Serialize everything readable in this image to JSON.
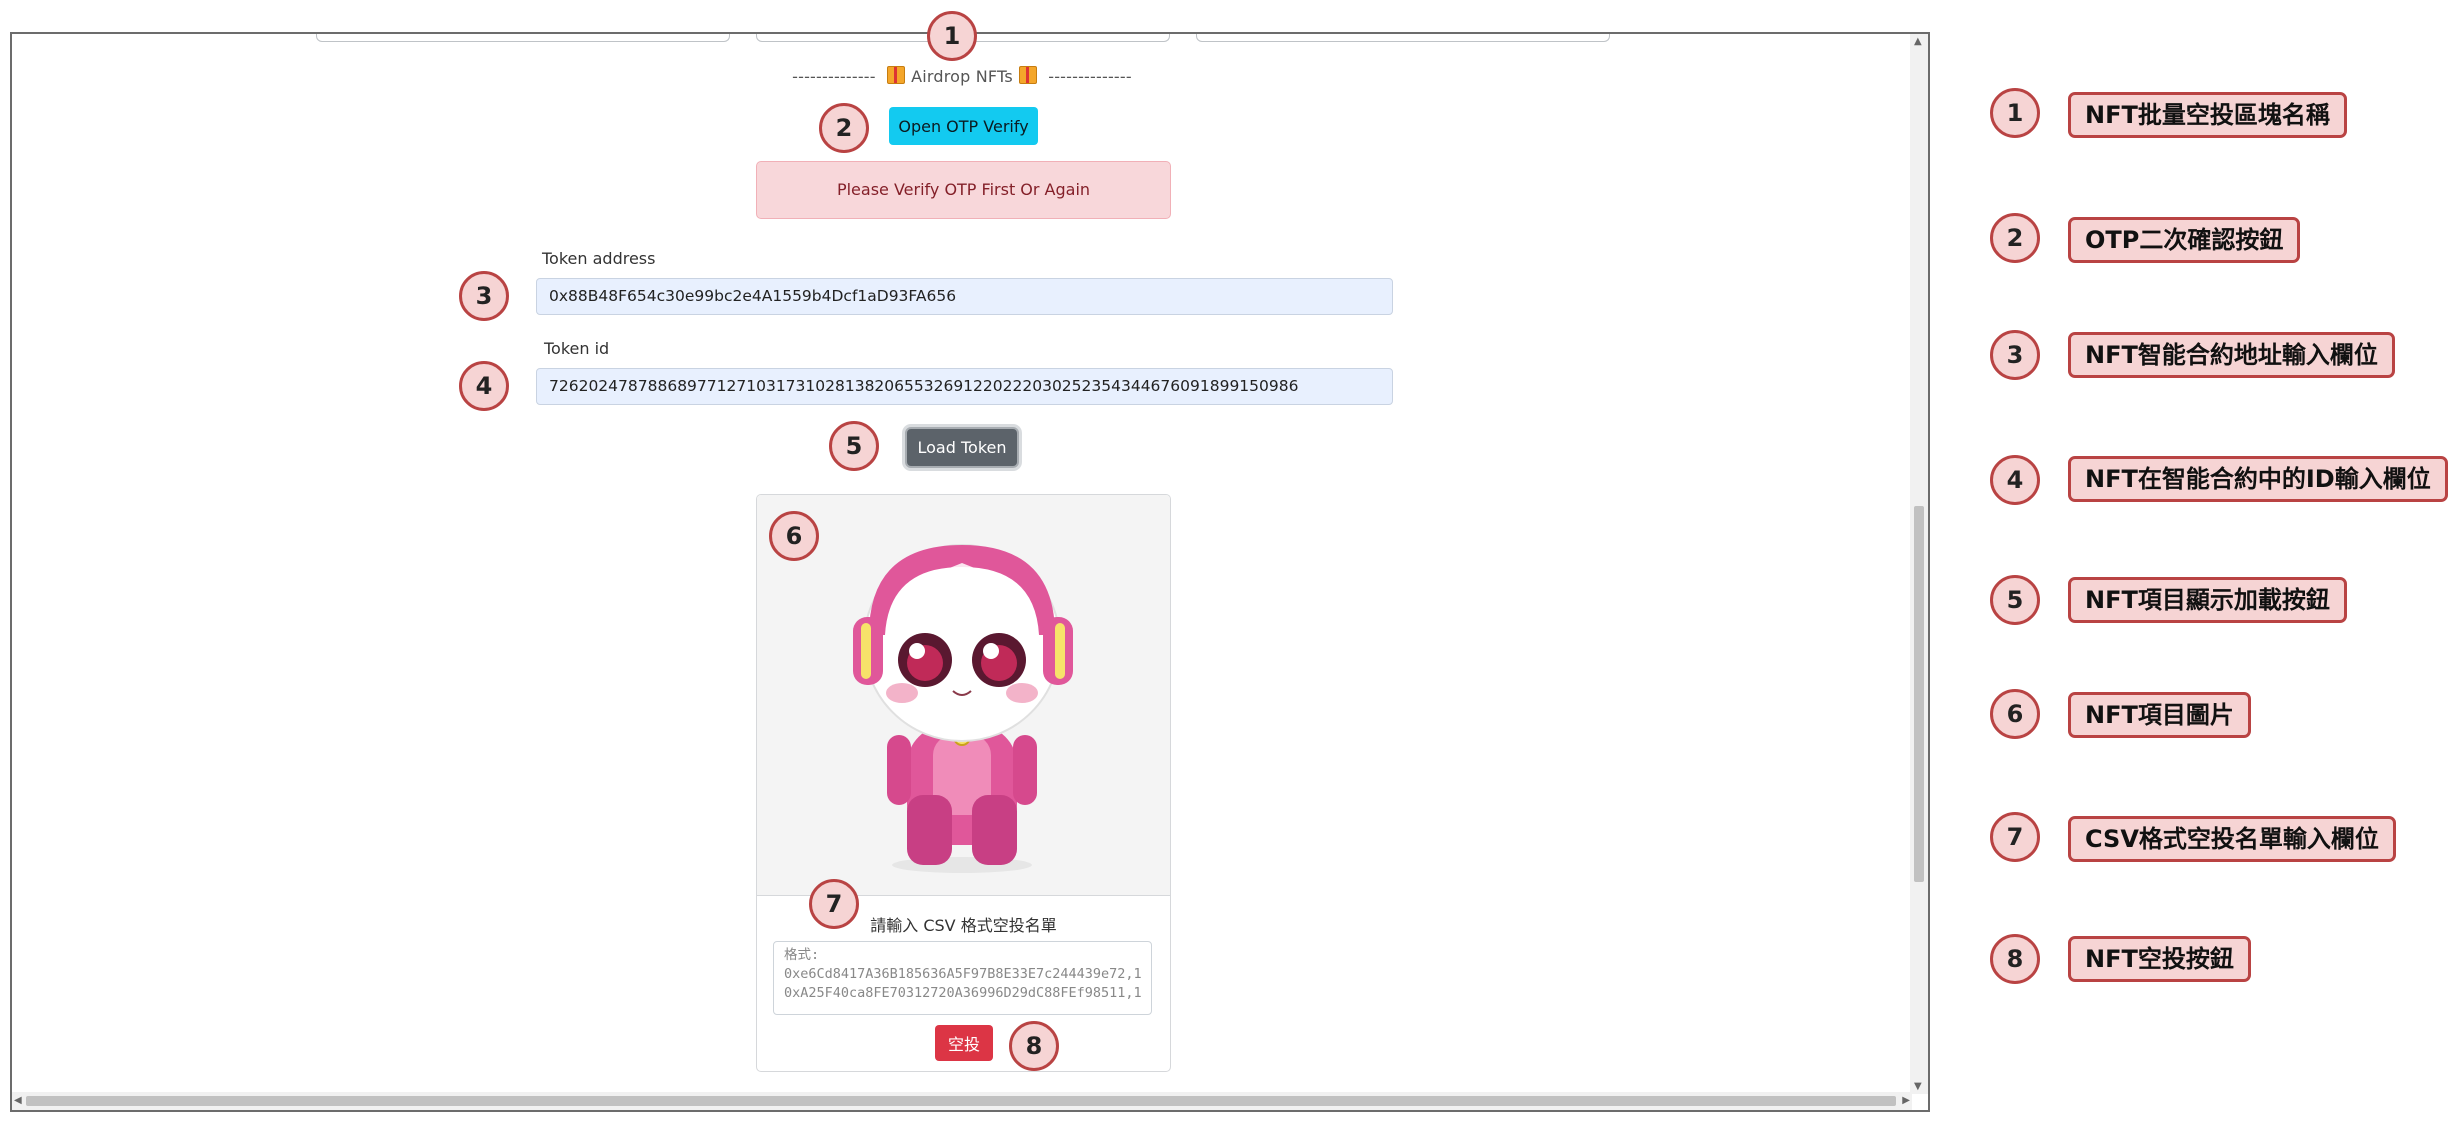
{
  "airdrop": {
    "section_title_left": "--------------",
    "section_title_text": "Airdrop NFTs",
    "section_title_right": "--------------",
    "otp_button": "Open OTP Verify",
    "alert_text": "Please Verify OTP First Or Again",
    "token_address_label": "Token address",
    "token_address_value": "0x88B48F654c30e99bc2e4A1559b4Dcf1aD93FA656",
    "token_id_label": "Token id",
    "token_id_value": "7262024787886897712710317310281382065532691220222030252354344676091899150986",
    "load_button": "Load Token",
    "csv_label": "請輸入 CSV 格式空投名單",
    "csv_placeholder": "格式:\n0xe6Cd8417A36B185636A5F97B8E33E7c244439e72,1\n0xA25F40ca8FE70312720A36996D29dC88FEf98511,1",
    "airdrop_button": "空投"
  },
  "annotations": [
    {
      "num": "1",
      "text": "NFT批量空投區塊名稱"
    },
    {
      "num": "2",
      "text": "OTP二次確認按鈕"
    },
    {
      "num": "3",
      "text": "NFT智能合約地址輸入欄位"
    },
    {
      "num": "4",
      "text": "NFT在智能合約中的ID輸入欄位"
    },
    {
      "num": "5",
      "text": "NFT項目顯示加載按鈕"
    },
    {
      "num": "6",
      "text": "NFT項目圖片"
    },
    {
      "num": "7",
      "text": "CSV格式空投名單輸入欄位"
    },
    {
      "num": "8",
      "text": "NFT空投按鈕"
    }
  ],
  "colors": {
    "marker_border": "#b94343",
    "marker_fill": "#f6d4d4",
    "otp_button": "#13caf0",
    "load_button": "#5c636a",
    "airdrop_button": "#dc3545",
    "alert_bg": "#f8d7da",
    "robot_pink": "#e0579a"
  }
}
